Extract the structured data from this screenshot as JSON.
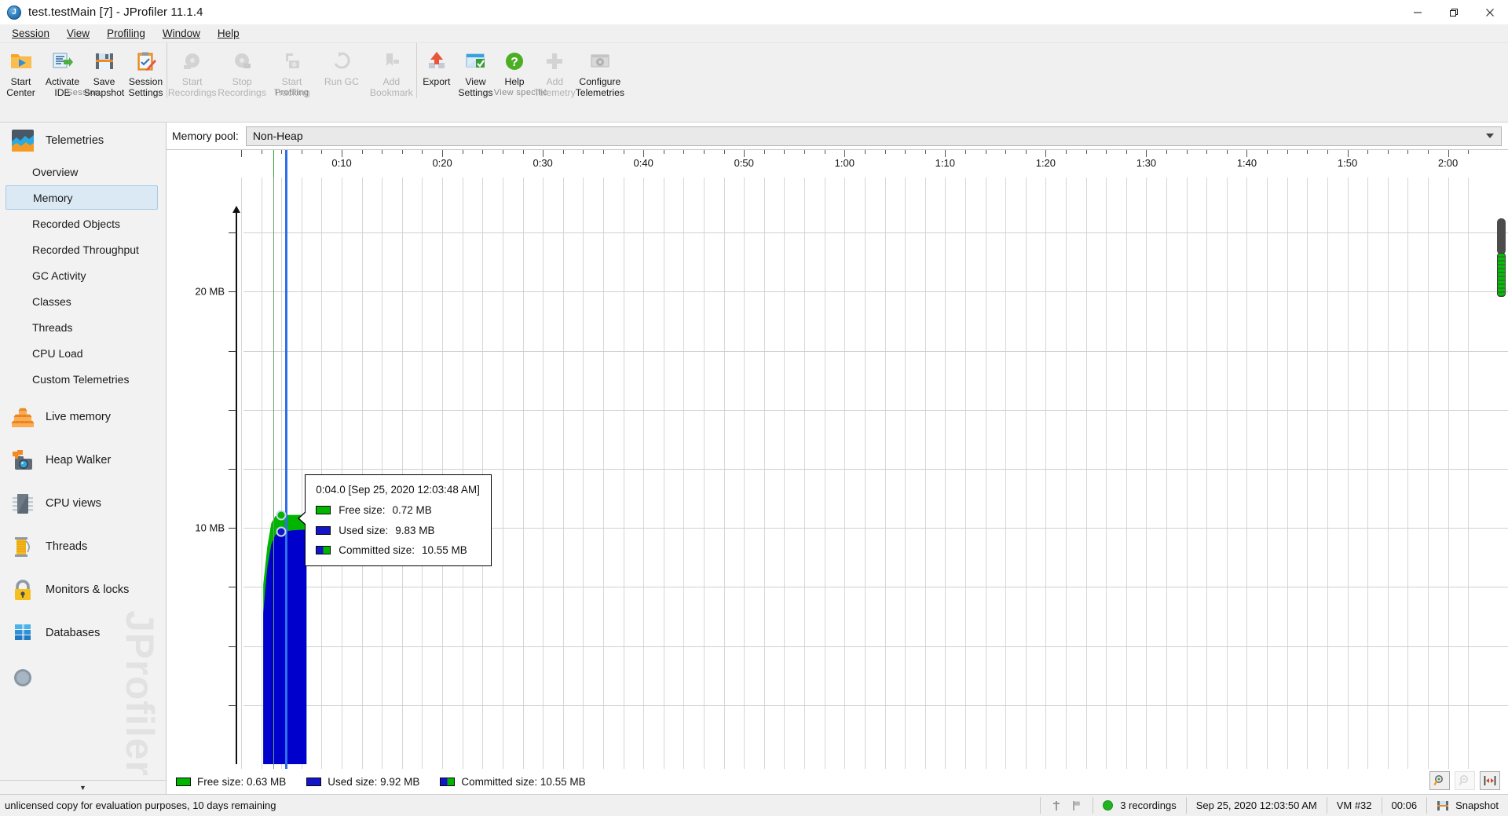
{
  "window": {
    "title": "test.testMain [7] - JProfiler 11.1.4",
    "app_icon": "jprofiler-logo-icon",
    "minimize": "—",
    "maximize": "❐",
    "close": "✕"
  },
  "menu": {
    "items": [
      {
        "label": "Session",
        "mnemonic": "S"
      },
      {
        "label": "View",
        "mnemonic": "V"
      },
      {
        "label": "Profiling",
        "mnemonic": "P"
      },
      {
        "label": "Window",
        "mnemonic": "W"
      },
      {
        "label": "Help",
        "mnemonic": "H"
      }
    ]
  },
  "toolbar": {
    "groups": [
      {
        "label": "Session",
        "buttons": [
          {
            "name": "start-center",
            "label": "Start\nCenter",
            "icon": "folder-play-icon",
            "enabled": true
          },
          {
            "name": "activate-ide",
            "label": "Activate\nIDE",
            "icon": "ide-arrow-icon",
            "enabled": true
          },
          {
            "name": "save-snapshot",
            "label": "Save\nSnapshot",
            "icon": "floppy-disk-icon",
            "enabled": true
          },
          {
            "name": "session-settings",
            "label": "Session\nSettings",
            "icon": "clipboard-pencil-icon",
            "enabled": true
          }
        ]
      },
      {
        "label": "Profiling",
        "buttons": [
          {
            "name": "start-recordings",
            "label": "Start\nRecordings",
            "icon": "record-reel-icon",
            "enabled": false
          },
          {
            "name": "stop-recordings",
            "label": "Stop\nRecordings",
            "icon": "stop-reel-icon",
            "enabled": false
          },
          {
            "name": "start-tracking",
            "label": "Start\nTracking",
            "icon": "camera-tracking-icon",
            "enabled": false
          },
          {
            "name": "run-gc",
            "label": "Run GC",
            "icon": "recycle-icon",
            "enabled": false
          },
          {
            "name": "add-bookmark",
            "label": "Add\nBookmark",
            "icon": "bookmark-icon",
            "enabled": false
          }
        ]
      },
      {
        "label": "View specific",
        "buttons": [
          {
            "name": "export",
            "label": "Export",
            "icon": "export-up-arrow-icon",
            "enabled": true
          },
          {
            "name": "view-settings",
            "label": "View\nSettings",
            "icon": "window-check-icon",
            "enabled": true
          },
          {
            "name": "help",
            "label": "Help",
            "icon": "green-question-icon",
            "enabled": true
          },
          {
            "name": "add-telemetry",
            "label": "Add\nTelemetry",
            "icon": "plus-icon",
            "enabled": false
          },
          {
            "name": "configure-telemetries",
            "label": "Configure\nTelemetries",
            "icon": "window-gear-icon",
            "enabled": false
          }
        ]
      }
    ]
  },
  "sidebar": {
    "watermark": "JProfiler",
    "sections": [
      {
        "name": "telemetries",
        "label": "Telemetries",
        "icon": "telemetries-chart-icon",
        "items": [
          {
            "name": "overview",
            "label": "Overview",
            "selected": false
          },
          {
            "name": "memory",
            "label": "Memory",
            "selected": true
          },
          {
            "name": "recorded-objects",
            "label": "Recorded Objects",
            "selected": false
          },
          {
            "name": "recorded-throughput",
            "label": "Recorded Throughput",
            "selected": false
          },
          {
            "name": "gc-activity",
            "label": "GC Activity",
            "selected": false
          },
          {
            "name": "classes",
            "label": "Classes",
            "selected": false
          },
          {
            "name": "threads",
            "label": "Threads",
            "selected": false
          },
          {
            "name": "cpu-load",
            "label": "CPU Load",
            "selected": false
          },
          {
            "name": "custom-telemetries",
            "label": "Custom Telemetries",
            "selected": false
          }
        ]
      },
      {
        "name": "live-memory",
        "label": "Live memory",
        "icon": "orange-cubes-icon",
        "items": []
      },
      {
        "name": "heap-walker",
        "label": "Heap Walker",
        "icon": "camera-cubes-icon",
        "items": []
      },
      {
        "name": "cpu-views",
        "label": "CPU views",
        "icon": "cpu-chip-icon",
        "items": []
      },
      {
        "name": "threads",
        "label": "Threads",
        "icon": "thread-spool-icon",
        "items": []
      },
      {
        "name": "monitors-locks",
        "label": "Monitors & locks",
        "icon": "padlock-icon",
        "items": []
      },
      {
        "name": "databases",
        "label": "Databases",
        "icon": "database-stack-icon",
        "items": []
      }
    ],
    "collapse_glyph": "▼"
  },
  "main": {
    "pool_label": "Memory pool:",
    "pool_value": "Non-Heap",
    "pool_options": [
      "Non-Heap"
    ]
  },
  "chart_data": {
    "type": "area",
    "title": "Memory",
    "xlabel": "",
    "ylabel": "",
    "grid": true,
    "legend_position": "bottom",
    "xtick_labels": [
      "0:10",
      "0:20",
      "0:30",
      "0:40",
      "0:50",
      "1:00",
      "1:10",
      "1:20",
      "1:30",
      "1:40",
      "1:50",
      "2:00"
    ],
    "xtick_seconds": [
      10,
      20,
      30,
      40,
      50,
      60,
      70,
      80,
      90,
      100,
      110,
      120
    ],
    "xlim_seconds": [
      0,
      123
    ],
    "ytick_labels": [
      "10 MB",
      "20 MB"
    ],
    "ytick_values": [
      10,
      20
    ],
    "ylim": [
      0,
      23.5
    ],
    "series": [
      {
        "name": "Committed size",
        "color": "#00b400",
        "unit": "MB",
        "current": 10.55,
        "at_cursor": 10.55
      },
      {
        "name": "Used size",
        "color": "#0000cd",
        "unit": "MB",
        "current": 9.92,
        "at_cursor": 9.83
      },
      {
        "name": "Free size",
        "color": "#00b400",
        "unit": "MB",
        "current": 0.63,
        "at_cursor": 0.72
      }
    ],
    "x": [
      2.2,
      2.6,
      3.0,
      3.4,
      3.8,
      4.0,
      4.4,
      4.8,
      5.2,
      5.6,
      6.0,
      6.5
    ],
    "committed": [
      7.6,
      9.2,
      10.2,
      10.5,
      10.55,
      10.55,
      10.55,
      10.55,
      10.55,
      10.55,
      10.55,
      10.55
    ],
    "used": [
      6.4,
      8.3,
      9.3,
      9.7,
      9.8,
      9.83,
      9.86,
      9.88,
      9.9,
      9.91,
      9.92,
      9.92
    ],
    "cursor_x": 4.0
  },
  "tooltip": {
    "time": "0:04.0 [Sep 25, 2020 12:03:48 AM]",
    "rows": [
      {
        "name": "Free size:",
        "value": "0.72 MB",
        "swatch": "green"
      },
      {
        "name": "Used size:",
        "value": "9.83 MB",
        "swatch": "blue"
      },
      {
        "name": "Committed size:",
        "value": "10.55 MB",
        "swatch": "blue-green"
      }
    ]
  },
  "legend": {
    "items": [
      {
        "name": "free-size",
        "text": "Free size: 0.63 MB",
        "swatch": "green"
      },
      {
        "name": "used-size",
        "text": "Used size: 9.92 MB",
        "swatch": "blue"
      },
      {
        "name": "committed-size",
        "text": "Committed size: 10.55 MB",
        "swatch": "blue-green"
      }
    ]
  },
  "chart_controls": {
    "zoom_in": "zoom-in-icon",
    "zoom_out": "zoom-out-icon",
    "fit": "fit-width-icon"
  },
  "statusbar": {
    "license": "unlicensed copy for evaluation purposes, 10 days remaining",
    "recordings": "3 recordings",
    "timestamp": "Sep 25, 2020 12:03:50 AM",
    "vm": "VM #32",
    "elapsed": "00:06",
    "snapshot": "Snapshot"
  }
}
